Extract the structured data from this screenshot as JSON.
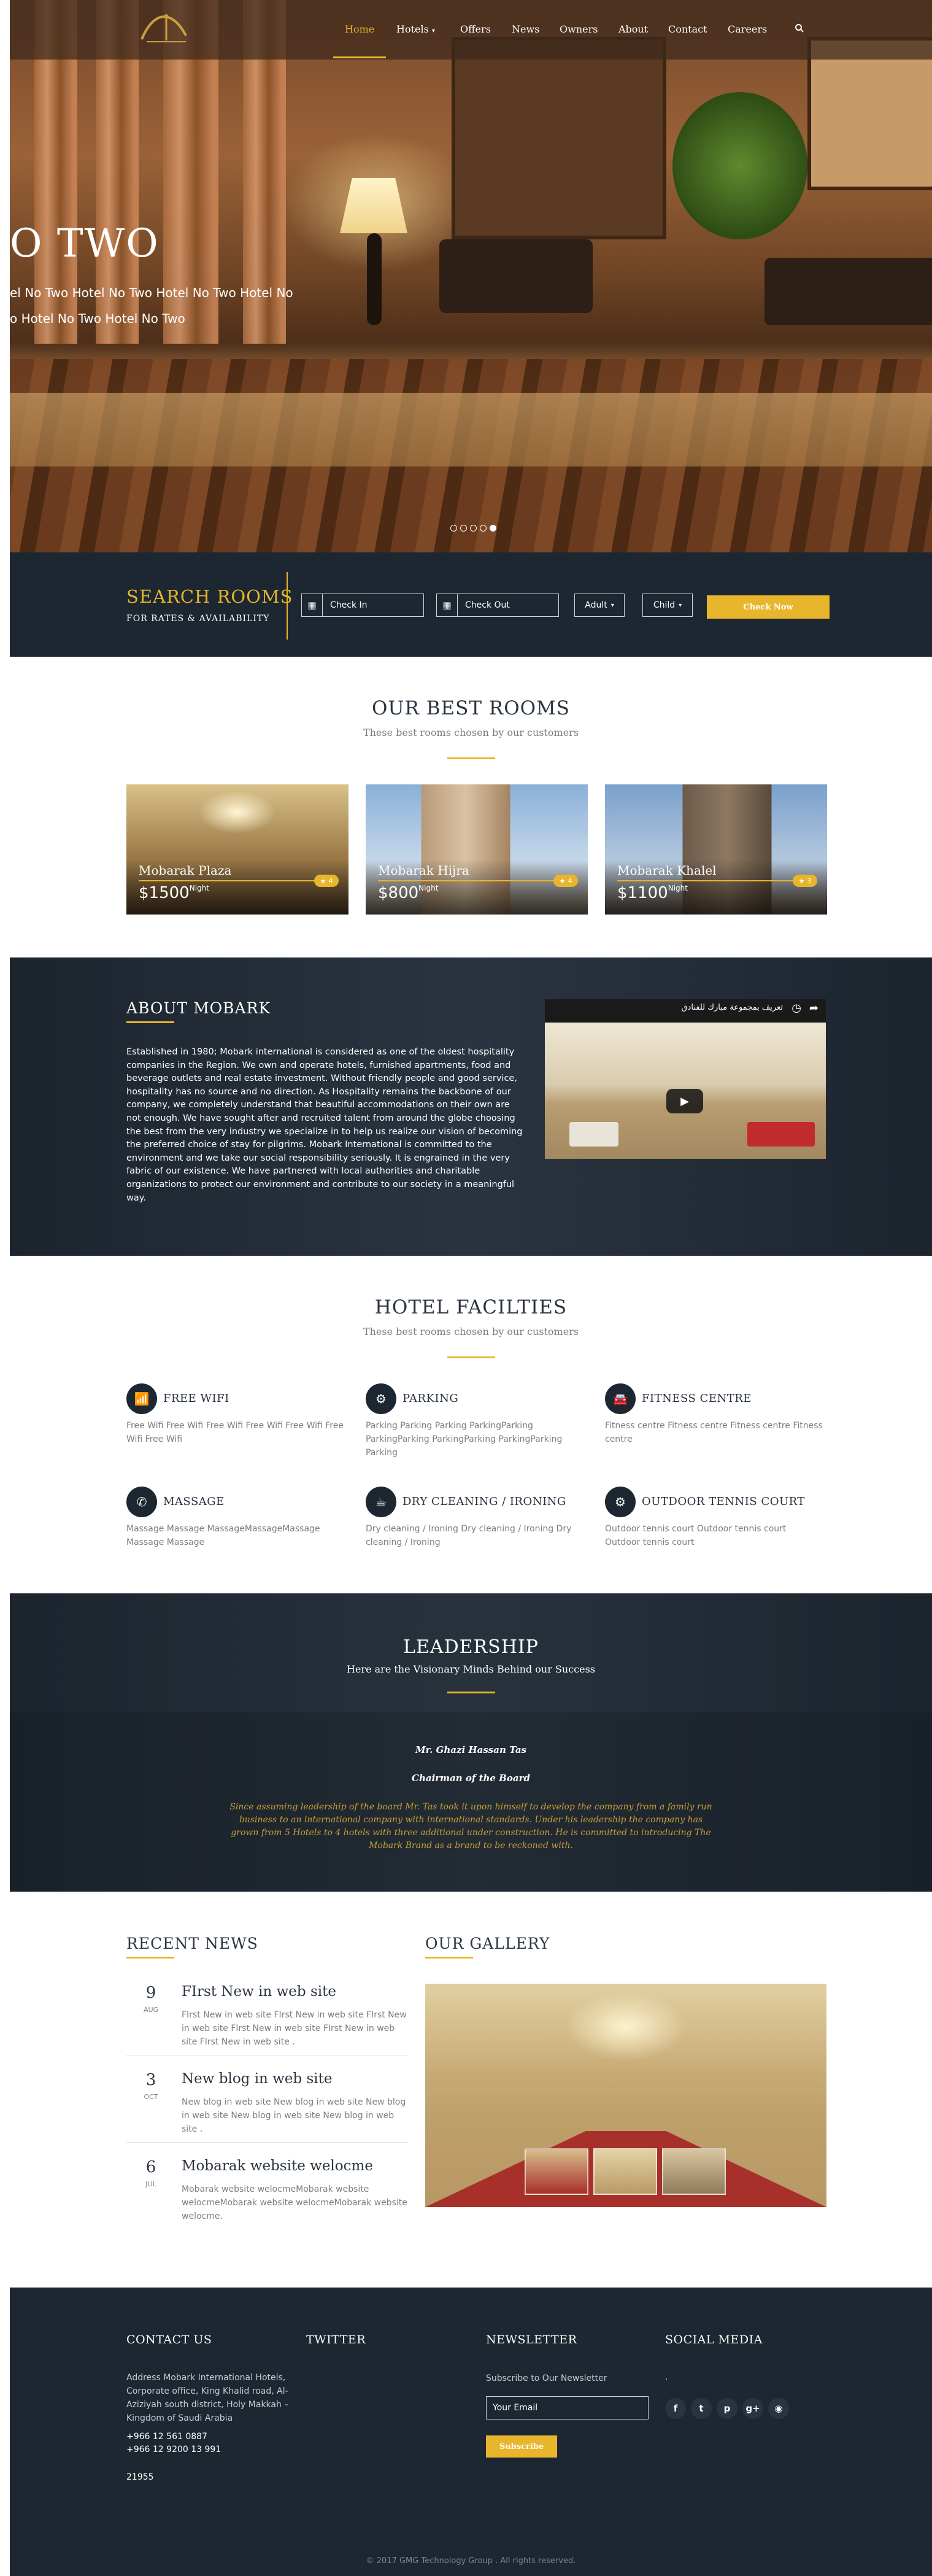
{
  "nav": {
    "items": [
      "Home",
      "Hotels",
      "Offers",
      "News",
      "Owners",
      "About",
      "Contact",
      "Careers"
    ]
  },
  "hero": {
    "title": "O TWO",
    "subtitle_line1": "el No Two Hotel No Two Hotel No Two Hotel No",
    "subtitle_line2": "o Hotel No Two Hotel No Two",
    "slides_total": 5,
    "active_slide": 5
  },
  "search": {
    "title": "SEARCH ROOMS",
    "subtitle": "FOR RATES & AVAILABILITY",
    "check_in": "Check In",
    "check_out": "Check Out",
    "adult": "Adult",
    "child": "Child",
    "button": "Check Now"
  },
  "rooms": {
    "title": "OUR BEST ROOMS",
    "subtitle": "These best rooms chosen by our customers",
    "per_label": "Night",
    "items": [
      {
        "name": "Mobarak Plaza",
        "price": "$1500",
        "rating": "4"
      },
      {
        "name": "Mobarak Hijra",
        "price": "$800",
        "rating": "4"
      },
      {
        "name": "Mobarak Khalel",
        "price": "$1100",
        "rating": "3"
      }
    ]
  },
  "about": {
    "title": "ABOUT MOBARK",
    "text": "Established in 1980; Mobark international is considered as one of the oldest hospitality companies in the Region. We own and operate hotels, furnished apartments, food and beverage outlets and real estate investment. Without friendly people and good service, hospitality has no source and no direction. As Hospitality remains the backbone of our company, we completely understand that beautiful accommodations on their own are not enough. We have sought after and recruited talent from around the globe choosing the best from the very industry we specialize in to help us realize our vision of becoming the preferred choice of stay for pilgrims. Mobark International is committed to the environment and we take our social responsibility seriously. It is engrained in the very fabric of our existence. We have partnered with local authorities and charitable organizations to protect our environment and contribute to our society in a meaningful way.",
    "video_title": "تعريف بمجموعة مبارك للفنادق"
  },
  "facilities": {
    "title": "HOTEL FACILTIES",
    "subtitle": "These best rooms chosen by our customers",
    "items": [
      {
        "title": "FREE WIFI",
        "text": "Free Wifi Free Wifi Free Wifi Free Wifi Free Wifi Free Wifi Free Wifi"
      },
      {
        "title": "PARKING",
        "text": "Parking Parking Parking ParkingParking ParkingParking ParkingParking ParkingParking Parking"
      },
      {
        "title": "FITNESS CENTRE",
        "text": "Fitness centre Fitness centre Fitness centre Fitness centre"
      },
      {
        "title": "MASSAGE",
        "text": "Massage Massage MassageMassageMassage Massage Massage"
      },
      {
        "title": "DRY CLEANING / IRONING",
        "text": "Dry cleaning / Ironing Dry cleaning / Ironing Dry cleaning / Ironing"
      },
      {
        "title": "OUTDOOR TENNIS COURT",
        "text": "Outdoor tennis court Outdoor tennis court Outdoor tennis court"
      }
    ]
  },
  "leadership": {
    "title": "LEADERSHIP",
    "subtitle": "Here are the Visionary Minds Behind our Success",
    "name": "Mr. Ghazi Hassan Tas",
    "role": "Chairman of the Board",
    "quote": "Since assuming leadership of the board Mr. Tas took it upon himself to develop the company from a family run business to an international company with international standards. Under his leadership the company has grown from 5 Hotels to 4 hotels with three additional under construction. He is committed to introducing The Mobark Brand as a brand to be reckoned with."
  },
  "news": {
    "title": "RECENT NEWS",
    "items": [
      {
        "day": "9",
        "month": "AUG",
        "title": "FIrst New in web site",
        "text": "FIrst New in web site FIrst New in web site FIrst New in web site FIrst New in web site FIrst New in web site FIrst New in web site ."
      },
      {
        "day": "3",
        "month": "OCT",
        "title": "New blog in web site",
        "text": "New blog in web site New blog in web site New blog in web site New blog in web site New blog in web site ."
      },
      {
        "day": "6",
        "month": "JUL",
        "title": "Mobarak website welocme",
        "text": "Mobarak website welocmeMobarak website welocmeMobarak website welocmeMobarak website welocme."
      }
    ]
  },
  "gallery": {
    "title": "OUR GALLERY"
  },
  "footer": {
    "contact_title": "CONTACT US",
    "address": "Address Mobark International Hotels, Corporate office, King Khalid road, Al-Aziziyah south district, Holy Makkah – Kingdom of Saudi Arabia",
    "phone1": "+966 12 561 0887",
    "phone2": "+966 12 9200 13 991",
    "zip": "21955",
    "twitter_title": "TWITTER",
    "newsletter_title": "NEWSLETTER",
    "newsletter_label": "Subscribe to Our Newsletter",
    "newsletter_placeholder": "Your Email",
    "subscribe": "Subscribe",
    "social_title": "SOCIAL MEDIA",
    "social_note": ".",
    "social_icons": [
      "facebook-icon",
      "twitter-icon",
      "pinterest-icon",
      "google-plus-icon",
      "rss-icon"
    ],
    "copyright": "© 2017 GMG Technology Group . All rights reserved."
  },
  "colors": {
    "accent": "#e8b62c",
    "dark": "#1d2731"
  }
}
